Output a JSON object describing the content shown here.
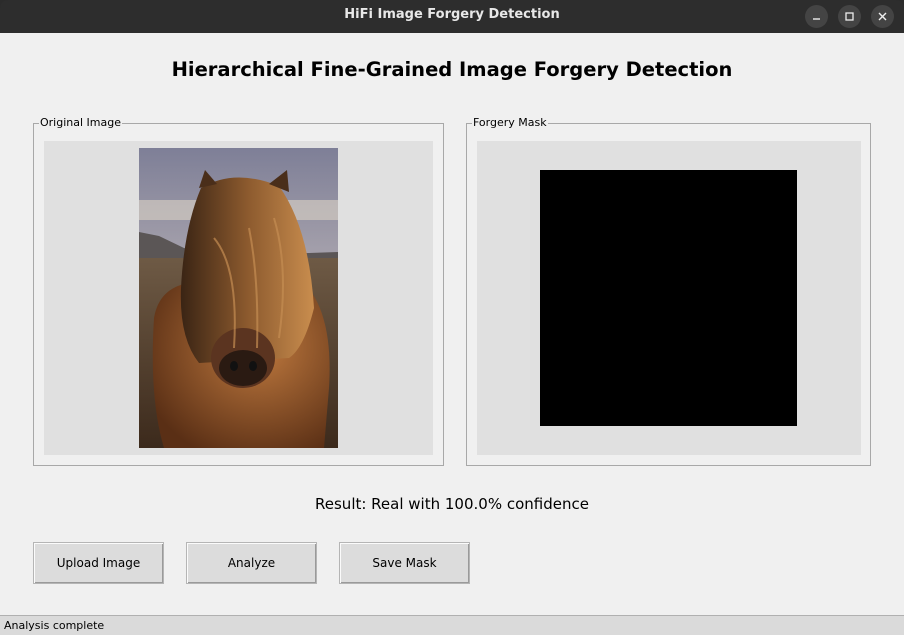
{
  "window": {
    "title": "HiFi Image Forgery Detection"
  },
  "icons": {
    "minimize": "minimize-icon",
    "maximize": "maximize-icon",
    "close": "close-icon"
  },
  "main": {
    "heading": "Hierarchical Fine-Grained Image Forgery Detection",
    "original_panel": {
      "label": "Original Image",
      "image_subject": "horse-photo"
    },
    "mask_panel": {
      "label": "Forgery Mask",
      "mask_state": "all black (no forged regions)"
    },
    "result_text": "Result: Real with 100.0% confidence"
  },
  "buttons": {
    "upload": "Upload Image",
    "analyze": "Analyze",
    "save_mask": "Save Mask"
  },
  "status": {
    "text": "Analysis complete"
  },
  "colors": {
    "titlebar": "#2d2d2d",
    "window_bg": "#f0f0f0",
    "panel_bg": "#e0e0e0",
    "mask": "#000000"
  }
}
